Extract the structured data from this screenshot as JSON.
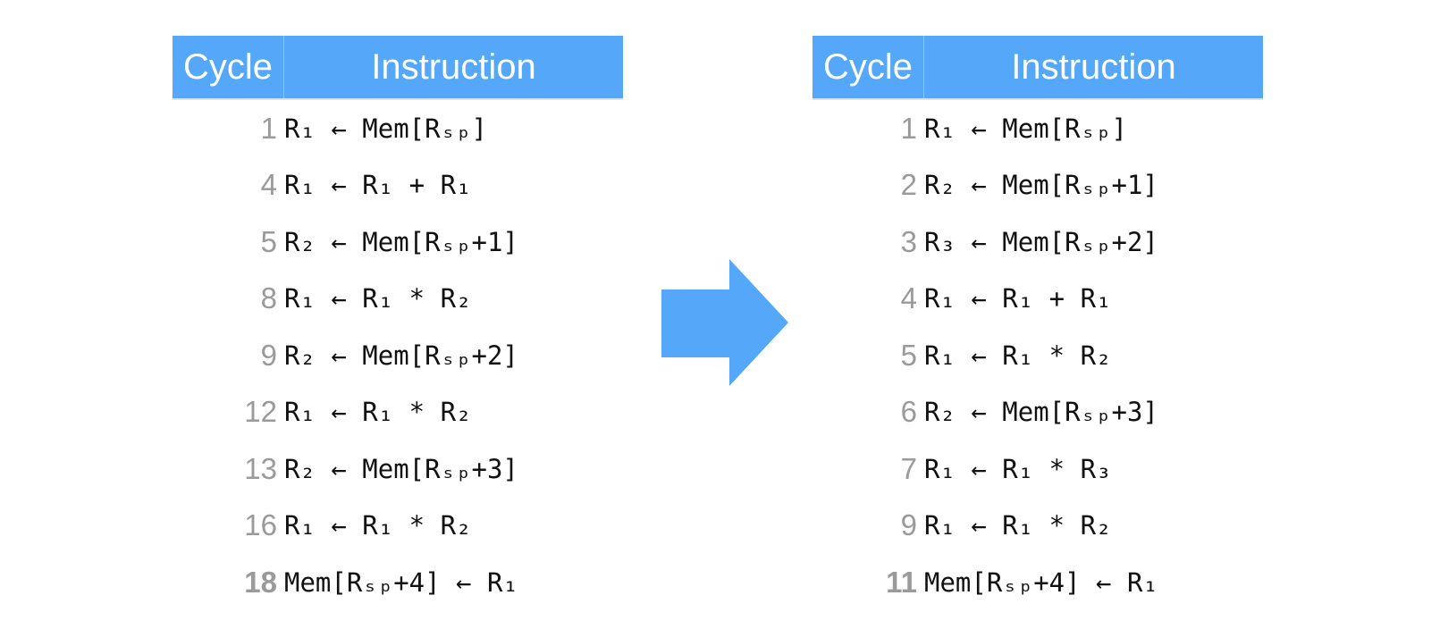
{
  "colors": {
    "header_bg": "#54a7f9",
    "header_text": "#ffffff",
    "arrow": "#54a7f9",
    "cycle_text": "#9a9a9a",
    "instruction_text": "#111111"
  },
  "left_table": {
    "headers": {
      "cycle": "Cycle",
      "instruction": "Instruction"
    },
    "rows": [
      {
        "cycle": "1",
        "instruction": "R₁ ← Mem[Rₛₚ]",
        "final": false
      },
      {
        "cycle": "4",
        "instruction": "R₁ ← R₁ + R₁",
        "final": false
      },
      {
        "cycle": "5",
        "instruction": "R₂ ← Mem[Rₛₚ+1]",
        "final": false
      },
      {
        "cycle": "8",
        "instruction": "R₁ ← R₁ * R₂",
        "final": false
      },
      {
        "cycle": "9",
        "instruction": "R₂ ← Mem[Rₛₚ+2]",
        "final": false
      },
      {
        "cycle": "12",
        "instruction": "R₁ ← R₁ * R₂",
        "final": false
      },
      {
        "cycle": "13",
        "instruction": "R₂ ← Mem[Rₛₚ+3]",
        "final": false
      },
      {
        "cycle": "16",
        "instruction": "R₁ ← R₁ * R₂",
        "final": false
      },
      {
        "cycle": "18",
        "instruction": "Mem[Rₛₚ+4] ← R₁",
        "final": true
      }
    ]
  },
  "arrow": {
    "icon": "right-arrow-icon",
    "direction": "right"
  },
  "right_table": {
    "headers": {
      "cycle": "Cycle",
      "instruction": "Instruction"
    },
    "rows": [
      {
        "cycle": "1",
        "instruction": "R₁ ← Mem[Rₛₚ]",
        "final": false
      },
      {
        "cycle": "2",
        "instruction": "R₂ ← Mem[Rₛₚ+1]",
        "final": false
      },
      {
        "cycle": "3",
        "instruction": "R₃ ← Mem[Rₛₚ+2]",
        "final": false
      },
      {
        "cycle": "4",
        "instruction": "R₁ ← R₁ + R₁",
        "final": false
      },
      {
        "cycle": "5",
        "instruction": "R₁ ← R₁ * R₂",
        "final": false
      },
      {
        "cycle": "6",
        "instruction": "R₂ ← Mem[Rₛₚ+3]",
        "final": false
      },
      {
        "cycle": "7",
        "instruction": "R₁ ← R₁ * R₃",
        "final": false
      },
      {
        "cycle": "9",
        "instruction": "R₁ ← R₁ * R₂",
        "final": false
      },
      {
        "cycle": "11",
        "instruction": "Mem[Rₛₚ+4] ← R₁",
        "final": true
      }
    ]
  }
}
